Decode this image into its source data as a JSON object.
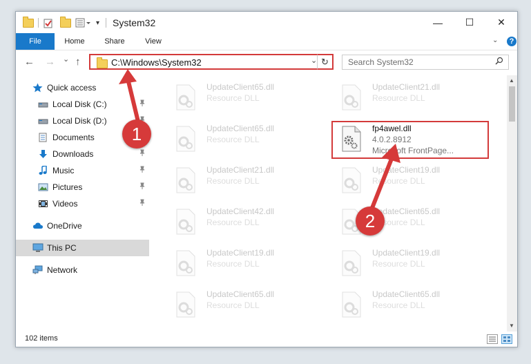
{
  "window": {
    "title": "System32",
    "minimize_glyph": "—",
    "maximize_glyph": "☐",
    "close_glyph": "✕"
  },
  "ribbon": {
    "tabs": [
      {
        "label": "File"
      },
      {
        "label": "Home"
      },
      {
        "label": "Share"
      },
      {
        "label": "View"
      }
    ],
    "help_glyph": "?",
    "expand_glyph": "⌄"
  },
  "navigation": {
    "back_glyph": "←",
    "forward_glyph": "→",
    "recent_glyph": "⌄",
    "up_glyph": "↑",
    "address": "C:\\Windows\\System32",
    "address_dropdown_glyph": "⌄",
    "refresh_glyph": "↻",
    "search_placeholder": "Search System32",
    "search_glyph": "⚲"
  },
  "sidebar": {
    "items": [
      {
        "label": "Quick access",
        "icon": "star-icon",
        "pinned": false
      },
      {
        "label": "Local Disk (C:)",
        "icon": "drive-icon",
        "pinned": true
      },
      {
        "label": "Local Disk (D:)",
        "icon": "drive-icon",
        "pinned": true
      },
      {
        "label": "Documents",
        "icon": "documents-icon",
        "pinned": true
      },
      {
        "label": "Downloads",
        "icon": "download-icon",
        "pinned": true
      },
      {
        "label": "Music",
        "icon": "music-icon",
        "pinned": true
      },
      {
        "label": "Pictures",
        "icon": "pictures-icon",
        "pinned": true
      },
      {
        "label": "Videos",
        "icon": "videos-icon",
        "pinned": true
      },
      {
        "label": "OneDrive",
        "icon": "cloud-icon",
        "pinned": false
      },
      {
        "label": "This PC",
        "icon": "computer-icon",
        "pinned": false,
        "selected": true
      },
      {
        "label": "Network",
        "icon": "network-icon",
        "pinned": false
      }
    ],
    "pin_glyph": "📌"
  },
  "files": {
    "left_column": [
      {
        "name": "UpdateClient65.dll",
        "type": "Resource DLL"
      },
      {
        "name": "UpdateClient65.dll",
        "type": "Resource DLL"
      },
      {
        "name": "UpdateClient21.dll",
        "type": "Resource DLL"
      },
      {
        "name": "UpdateClient42.dll",
        "type": "Resource DLL"
      },
      {
        "name": "UpdateClient19.dll",
        "type": "Resource DLL"
      },
      {
        "name": "UpdateClient65.dll",
        "type": "Resource DLL"
      }
    ],
    "right_column": [
      {
        "name": "UpdateClient21.dll",
        "type": "Resource DLL"
      },
      {
        "name": "UpdateClient19.dll",
        "type": "Resource DLL"
      },
      {
        "name": "UpdateClient65.dll",
        "type": "Resource DLL"
      },
      {
        "name": "UpdateClient19.dll",
        "type": "Resource DLL"
      },
      {
        "name": "UpdateClient65.dll",
        "type": "Resource DLL"
      }
    ],
    "highlighted": {
      "name": "fp4awel.dll",
      "version": "4.0.2.8912",
      "description": "Microsoft FrontPage..."
    }
  },
  "status": {
    "item_count": "102 items"
  },
  "callouts": {
    "one": "1",
    "two": "2"
  },
  "colors": {
    "accent": "#1979ca",
    "callout_red": "#d63a3a",
    "highlight_border": "#d33a3a"
  }
}
